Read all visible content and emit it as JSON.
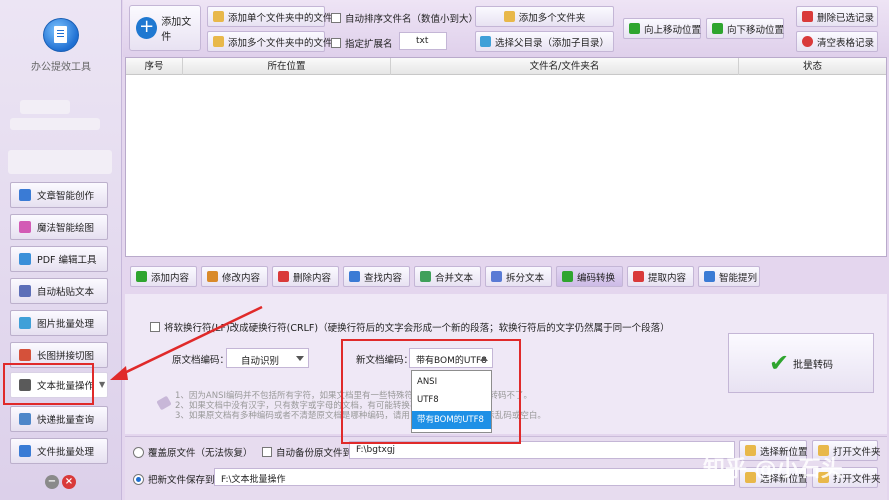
{
  "sidebar": {
    "app_name": "办公提效工具",
    "items": [
      {
        "label": "文章智能创作",
        "color": "#3a7bd5"
      },
      {
        "label": "魔法智能绘图",
        "color": "#d35bb5"
      },
      {
        "label": "PDF 编辑工具",
        "color": "#3a8fd9"
      },
      {
        "label": "自动粘贴文本",
        "color": "#5d6fb8"
      },
      {
        "label": "图片批量处理",
        "color": "#3fa0d8"
      },
      {
        "label": "长图拼接切图",
        "color": "#d5513a"
      },
      {
        "label": "文本批量操作",
        "color": "#5a5a5a"
      },
      {
        "label": "快递批量查询",
        "color": "#4e87c9"
      },
      {
        "label": "文件批量处理",
        "color": "#3a7bd5"
      }
    ],
    "active_index": 6
  },
  "toolbar": {
    "add_file": "添加文件",
    "add_single_folder": "添加单个文件夹中的文件",
    "add_multi_folder": "添加多个文件夹中的文件",
    "auto_sort": "自动排序文件名（数值小到大）",
    "specify_ext": "指定扩展名",
    "ext_value": "txt",
    "add_multi_folders": "添加多个文件夹",
    "select_parent": "选择父目录（添加子目录）",
    "move_up": "向上移动位置",
    "move_down": "向下移动位置",
    "delete_selected": "删除已选记录",
    "clear_table": "清空表格记录"
  },
  "table": {
    "columns": [
      "序号",
      "所在位置",
      "文件名/文件夹名",
      "状态"
    ]
  },
  "functions": [
    {
      "label": "添加内容",
      "color": "#2fa52f"
    },
    {
      "label": "修改内容",
      "color": "#d98a2a"
    },
    {
      "label": "删除内容",
      "color": "#d93a3a"
    },
    {
      "label": "查找内容",
      "color": "#3a7bd5"
    },
    {
      "label": "合并文本",
      "color": "#3fa05a"
    },
    {
      "label": "拆分文本",
      "color": "#5a7bd5"
    },
    {
      "label": "编码转换",
      "color": "#2fa52f"
    },
    {
      "label": "提取内容",
      "color": "#d93a3a"
    },
    {
      "label": "智能提列",
      "color": "#3a7bd5"
    }
  ],
  "functions_active_index": 6,
  "settings": {
    "lf_option": "将软换行符(LF)改成硬换行符(CRLF)（硬换行符后的文字会形成一个新的段落；软换行符后的文字仍然属于同一个段落）",
    "src_enc_label": "原文档编码：",
    "src_enc_value": "自动识别",
    "new_enc_label": "新文档编码：",
    "new_enc_value": "带有BOM的UTF8",
    "enc_options": [
      "ANSI",
      "UTF8",
      "带有BOM的UTF8"
    ],
    "enc_selected": 2,
    "note1": "1、因为ANSI编码并不包括所有字符，如果文档里有一些特殊符号，就有可能丢失或转码不了。",
    "note2": "2、如果文档中没有汉字，只有数字或字母的文档，有可能转换不了。",
    "note3": "3、如果原文档有多种编码或者不清楚原文档是哪种编码，请用，换成功的文件会显示乱码或空白。",
    "convert": "批量转码"
  },
  "bottom": {
    "overwrite": "覆盖原文件（无法恢复）",
    "auto_backup": "自动备份原文件到：",
    "backup_path": "F:\\bgtxgj",
    "save_new": "把新文件保存到：",
    "save_path": "F:\\文本批量操作",
    "choose_new": "选择新位置",
    "open_folder": "打开文件夹"
  },
  "watermark": "知乎 @小石头"
}
